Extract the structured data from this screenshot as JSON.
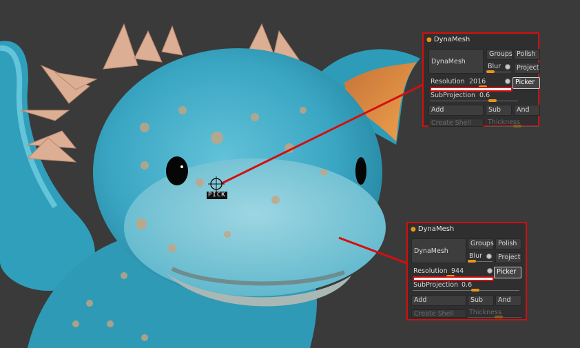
{
  "colors": {
    "panel_bg": "#2f2f2f",
    "callout_red": "#d40e0e",
    "slider_orange": "#e8931d",
    "model_teal": "#3ba6c3",
    "spikes_tan": "#e1b59a",
    "viewport_bg": "#3a3a3a"
  },
  "cursor": {
    "label": "PICK",
    "icon": "pick-target-icon"
  },
  "panels": [
    {
      "title": "DynaMesh",
      "dynamesh_button": "DynaMesh",
      "groups": "Groups",
      "polish": "Polish",
      "blur": "Blur",
      "project": "Project",
      "resolution_label": "Resolution",
      "resolution_value": "2016",
      "picker": "Picker",
      "subprojection_label": "SubProjection",
      "subprojection_value": "0.6",
      "add": "Add",
      "sub": "Sub",
      "and": "And",
      "create_shell": "Create Shell",
      "thickness": "Thickness"
    },
    {
      "title": "DynaMesh",
      "dynamesh_button": "DynaMesh",
      "groups": "Groups",
      "polish": "Polish",
      "blur": "Blur",
      "project": "Project",
      "resolution_label": "Resolution",
      "resolution_value": "944",
      "picker": "Picker",
      "subprojection_label": "SubProjection",
      "subprojection_value": "0.6",
      "add": "Add",
      "sub": "Sub",
      "and": "And",
      "create_shell": "Create Shell",
      "thickness": "Thickness"
    }
  ]
}
